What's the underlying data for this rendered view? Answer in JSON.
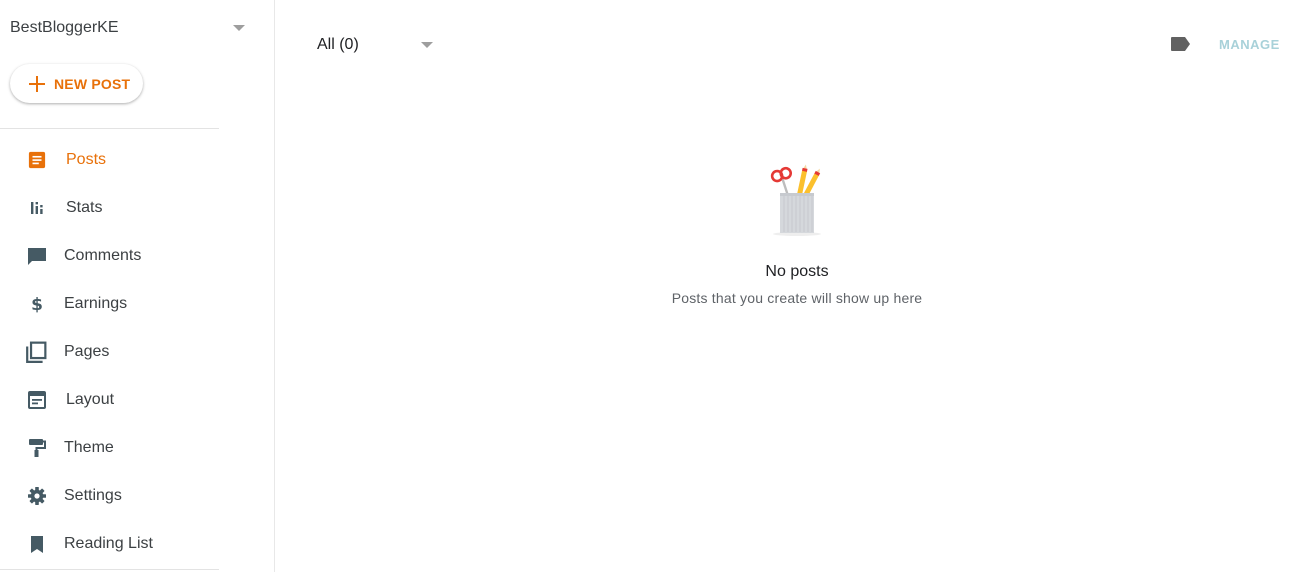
{
  "blog": {
    "name": "BestBloggerKE"
  },
  "new_post": {
    "label": "NEW POST"
  },
  "colors": {
    "accent": "#e8710a",
    "icon": "#455a64",
    "manage": "#a8d1d9"
  },
  "nav": {
    "items": [
      {
        "label": "Posts",
        "icon": "posts-icon",
        "active": true
      },
      {
        "label": "Stats",
        "icon": "stats-icon"
      },
      {
        "label": "Comments",
        "icon": "comment-icon"
      },
      {
        "label": "Earnings",
        "icon": "dollar-icon"
      },
      {
        "label": "Pages",
        "icon": "pages-icon"
      },
      {
        "label": "Layout",
        "icon": "layout-icon"
      },
      {
        "label": "Theme",
        "icon": "paint-roller-icon"
      },
      {
        "label": "Settings",
        "icon": "gear-icon"
      },
      {
        "label": "Reading List",
        "icon": "bookmark-icon"
      }
    ]
  },
  "toolbar": {
    "filter_label": "All (0)",
    "manage_label": "MANAGE"
  },
  "empty_state": {
    "title": "No posts",
    "subtitle": "Posts that you create will show up here"
  }
}
